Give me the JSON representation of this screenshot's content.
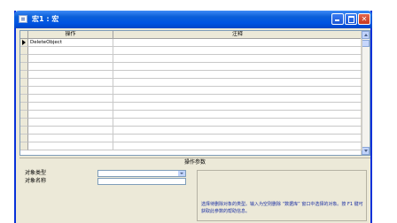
{
  "window": {
    "title": "宏1 : 宏"
  },
  "grid": {
    "columns": [
      "操作",
      "注释"
    ],
    "rows": [
      {
        "action": "DeleteObject",
        "comment": ""
      },
      {
        "action": "",
        "comment": ""
      },
      {
        "action": "",
        "comment": ""
      },
      {
        "action": "",
        "comment": ""
      },
      {
        "action": "",
        "comment": ""
      },
      {
        "action": "",
        "comment": ""
      },
      {
        "action": "",
        "comment": ""
      },
      {
        "action": "",
        "comment": ""
      },
      {
        "action": "",
        "comment": ""
      },
      {
        "action": "",
        "comment": ""
      },
      {
        "action": "",
        "comment": ""
      },
      {
        "action": "",
        "comment": ""
      },
      {
        "action": "",
        "comment": ""
      },
      {
        "action": "",
        "comment": ""
      }
    ]
  },
  "properties": {
    "header": "操作参数",
    "object_type_label": "对象类型",
    "object_type_value": "",
    "object_name_label": "对象名称",
    "object_name_value": "",
    "help_text": "选择待删除对象的类型。输入为空则删除 “数据库” 窗口中选择的对象。按 F1 键可获取此参数的帮助信息。"
  },
  "icons": [
    "macro-icon",
    "minimize-icon",
    "maximize-icon",
    "close-icon",
    "row-arrow-icon",
    "chevron-down-icon"
  ]
}
